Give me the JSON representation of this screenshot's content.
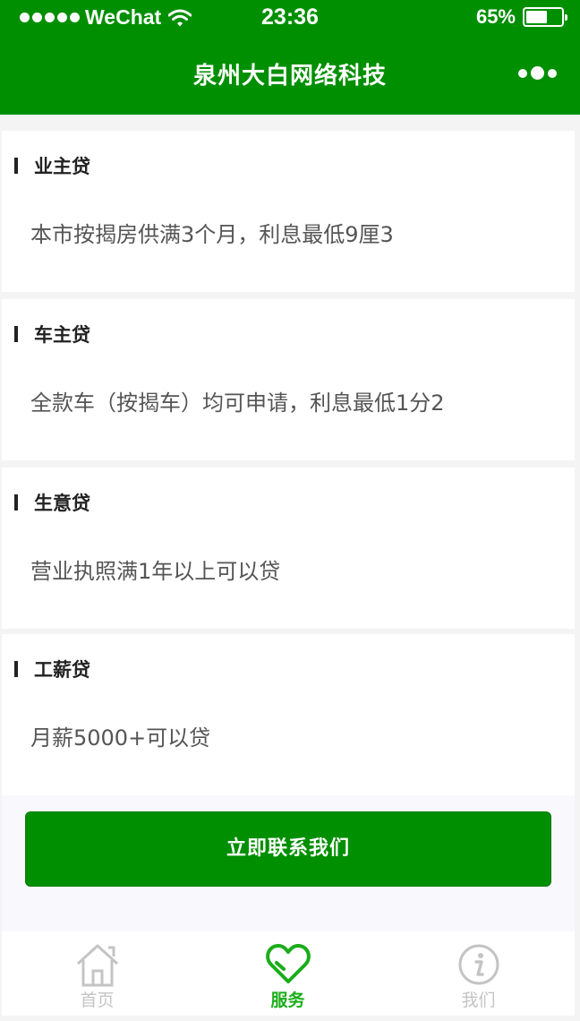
{
  "status_bar": {
    "carrier": "WeChat",
    "time": "23:36",
    "battery": "65%",
    "battery_level": 0.65
  },
  "nav": {
    "title": "泉州大白网络科技"
  },
  "cards": [
    {
      "title": "业主贷",
      "desc": "本市按揭房供满3个月，利息最低9厘3"
    },
    {
      "title": "车主贷",
      "desc": "全款车（按揭车）均可申请，利息最低1分2"
    },
    {
      "title": "生意贷",
      "desc": "营业执照满1年以上可以贷"
    },
    {
      "title": "工薪贷",
      "desc": "月薪5000+可以贷"
    }
  ],
  "contact_button": "立即联系我们",
  "tabs": [
    {
      "label": "首页",
      "icon": "home-icon",
      "active": false
    },
    {
      "label": "服务",
      "icon": "heart-icon",
      "active": true
    },
    {
      "label": "我们",
      "icon": "info-icon",
      "active": false
    }
  ],
  "colors": {
    "primary": "#008f00",
    "tab_active": "#1aad19",
    "tab_inactive": "#c4c4c4"
  }
}
